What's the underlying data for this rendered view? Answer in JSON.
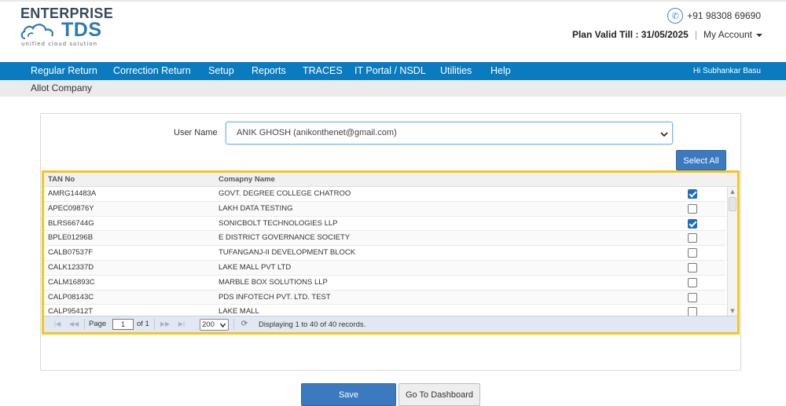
{
  "header": {
    "logo_top": "ENTERPRISE",
    "logo_main": "TDS",
    "logo_sub": "unified cloud solution",
    "phone": "+91 98308 69690",
    "plan_valid": "Plan Valid Till : 31/05/2025",
    "separator": "|",
    "my_account": "My Account"
  },
  "nav": {
    "items": [
      "Regular Return",
      "Correction Return",
      "Setup",
      "Reports",
      "TRACES",
      "IT Portal / NSDL",
      "Utilities",
      "Help"
    ],
    "user_greeting": "Hi Subhankar Basu"
  },
  "breadcrumb": "Allot Company",
  "form": {
    "user_label": "User Name",
    "user_value": "ANIK GHOSH (anikonthenet@gmail.com)",
    "select_all": "Select All"
  },
  "grid": {
    "columns": [
      "TAN No",
      "Comapny Name"
    ],
    "rows": [
      {
        "tan": "AMRG14483A",
        "name": "GOVT. DEGREE COLLEGE CHATROO",
        "checked": true
      },
      {
        "tan": "APEC09876Y",
        "name": "LAKH DATA TESTING",
        "checked": false
      },
      {
        "tan": "BLRS66744G",
        "name": "SONICBOLT TECHNOLOGIES LLP",
        "checked": true
      },
      {
        "tan": "BPLE01296B",
        "name": "E DISTRICT GOVERNANCE SOCIETY",
        "checked": false
      },
      {
        "tan": "CALB07537F",
        "name": "TUFANGANJ-II DEVELOPMENT BLOCK",
        "checked": false
      },
      {
        "tan": "CALK12337D",
        "name": "LAKE MALL PVT LTD",
        "checked": false
      },
      {
        "tan": "CALM16893C",
        "name": "MARBLE BOX SOLUTIONS LLP",
        "checked": false
      },
      {
        "tan": "CALP08143C",
        "name": "PDS INFOTECH PVT. LTD. TEST",
        "checked": false
      },
      {
        "tan": "CALP95412T",
        "name": "LAKE MALL",
        "checked": false
      }
    ],
    "pager": {
      "page_label": "Page",
      "page_value": "1",
      "of_label": "of 1",
      "page_size": "200",
      "display_text": "Displaying 1 to 40 of 40 records."
    }
  },
  "actions": {
    "save": "Save",
    "dashboard": "Go To Dashboard"
  },
  "colors": {
    "nav_bg": "#0b7bbf",
    "button_blue": "#3b7abe",
    "highlight_border": "#f3c624",
    "checkbox_checked": "#1a6fc4"
  }
}
